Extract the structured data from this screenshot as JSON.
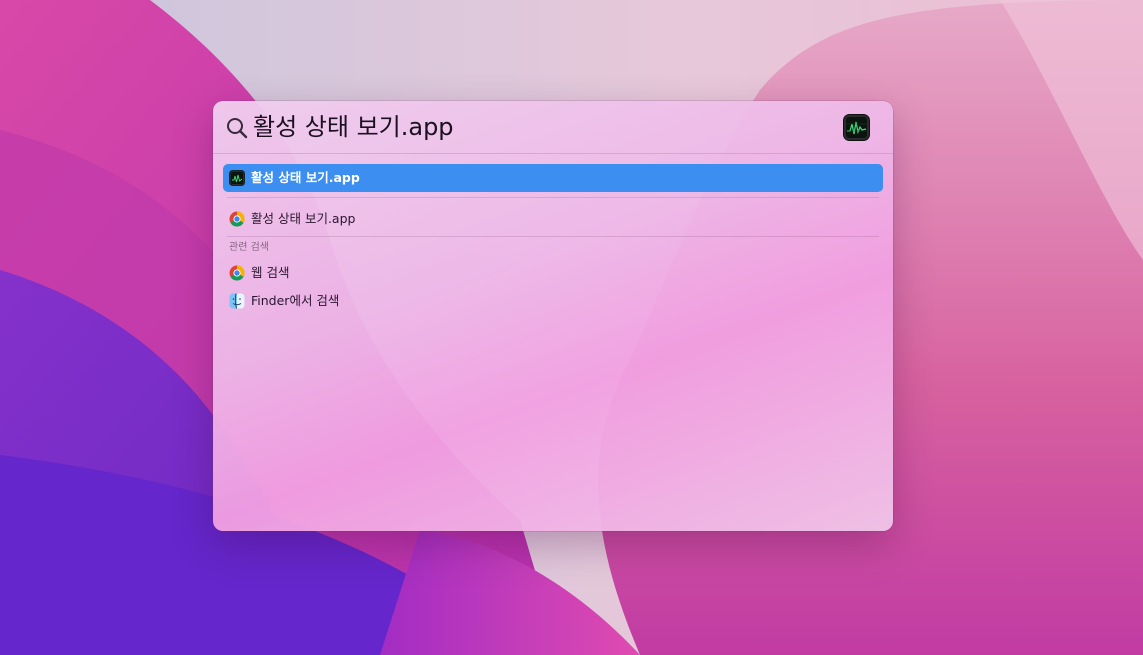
{
  "spotlight": {
    "query": "활성 상태 보기.app",
    "search_icon": "magnifying-glass-icon",
    "preview_icon": "activity-monitor-icon",
    "top_hit": {
      "label": "활성 상태 보기.app",
      "icon": "activity-monitor-icon",
      "selected": true
    },
    "results": [
      {
        "label": "활성 상태 보기.app",
        "icon": "chrome-icon"
      }
    ],
    "related_section": {
      "title": "관련 검색",
      "items": [
        {
          "label": "웹 검색",
          "icon": "chrome-icon"
        },
        {
          "label": "Finder에서 검색",
          "icon": "finder-icon"
        }
      ]
    }
  },
  "colors": {
    "selection": "#3c8ef0",
    "wallpaper_magenta": "#c13fb0",
    "wallpaper_purple": "#6a2fcf"
  }
}
